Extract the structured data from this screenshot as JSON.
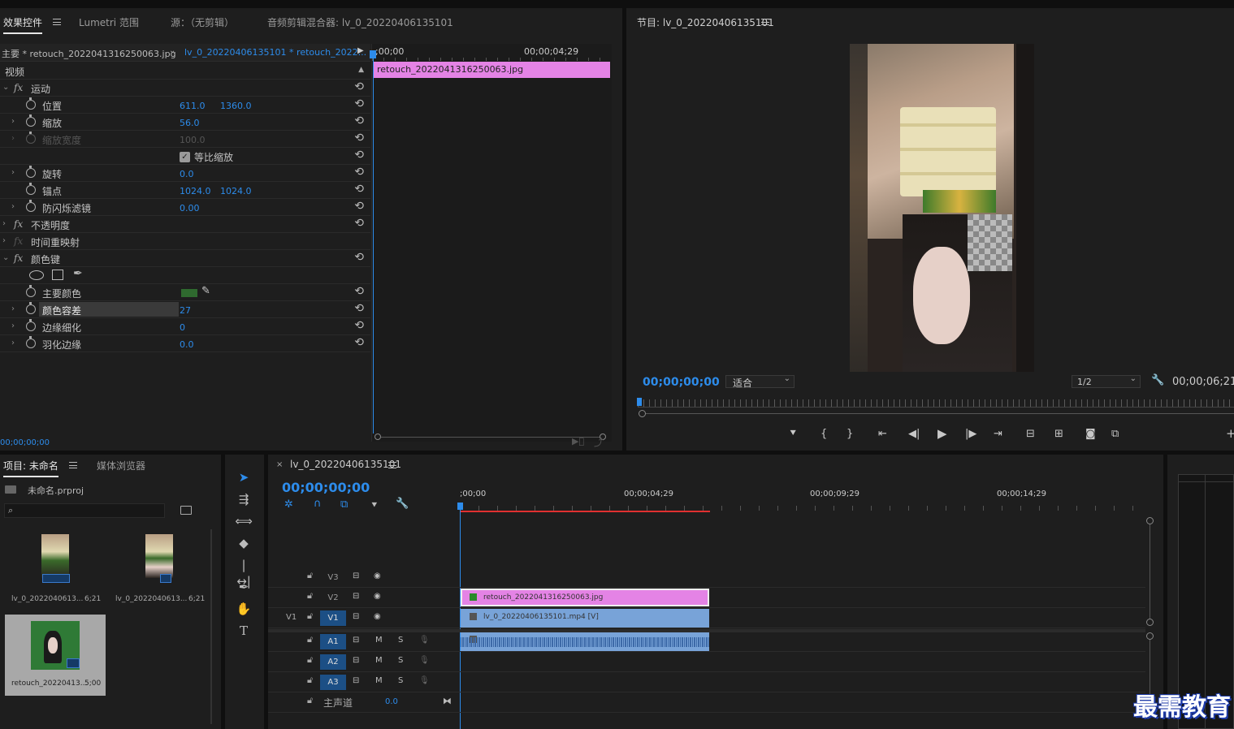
{
  "effect_controls": {
    "tabs": [
      "效果控件",
      "Lumetri 范围",
      "源：（无剪辑）",
      "音频剪辑混合器: lv_0_20220406135101"
    ],
    "master_label": "主要 * retouch_2022041316250063.jpg",
    "sequence_label": "lv_0_20220406135101 * retouch_2022...",
    "time_start": ";00;00",
    "time_end": "00;00;04;29",
    "clip_name": "retouch_2022041316250063.jpg",
    "section_video": "视频",
    "rows": {
      "motion": "运动",
      "position": "位置",
      "position_x": "611.0",
      "position_y": "1360.0",
      "scale": "缩放",
      "scale_v": "56.0",
      "scale_width": "缩放宽度",
      "scale_width_v": "100.0",
      "uniform_scale": "等比缩放",
      "rotation": "旋转",
      "rotation_v": "0.0",
      "anchor": "锚点",
      "anchor_x": "1024.0",
      "anchor_y": "1024.0",
      "flicker": "防闪烁滤镜",
      "flicker_v": "0.00",
      "opacity": "不透明度",
      "time_remap": "时间重映射",
      "color_key": "颜色键",
      "key_color": "主要颜色",
      "color_tolerance": "颜色容差",
      "color_tolerance_v": "27",
      "edge_thin": "边缘细化",
      "edge_thin_v": "0",
      "feather": "羽化边缘",
      "feather_v": "0.0"
    },
    "timecode": "00;00;00;00"
  },
  "program": {
    "title": "节目: lv_0_20220406135101",
    "timecode": "00;00;00;00",
    "fit_label": "适合",
    "resolution": "1/2",
    "duration": "00;00;06;21"
  },
  "project": {
    "tabs": [
      "项目: 未命名",
      "媒体浏览器"
    ],
    "file": "未命名.prproj",
    "items": [
      {
        "name": "lv_0_2022040613...",
        "dur": "6;21"
      },
      {
        "name": "lv_0_2022040613...",
        "dur": "6;21"
      },
      {
        "name": "retouch_20220413...",
        "dur": "5;00"
      }
    ]
  },
  "timeline": {
    "title": "lv_0_20220406135101",
    "timecode": "00;00;00;00",
    "ruler": [
      ";00;00",
      "00;00;04;29",
      "00;00;09;29",
      "00;00;14;29"
    ],
    "tracks": [
      "V3",
      "V2",
      "V1",
      "A1",
      "A2",
      "A3"
    ],
    "v1_source": "V1",
    "master": "主声道",
    "master_value": "0.0",
    "clip_v2": "retouch_2022041316250063.jpg",
    "clip_v1": "lv_0_20220406135101.mp4 [V]",
    "mute": "M",
    "solo": "S"
  },
  "watermark": "最需教育",
  "colors": {
    "accent": "#2d8ceb",
    "clip_pink": "#e483e5",
    "clip_blue": "#78a3d8",
    "playhead": "#e03030"
  }
}
